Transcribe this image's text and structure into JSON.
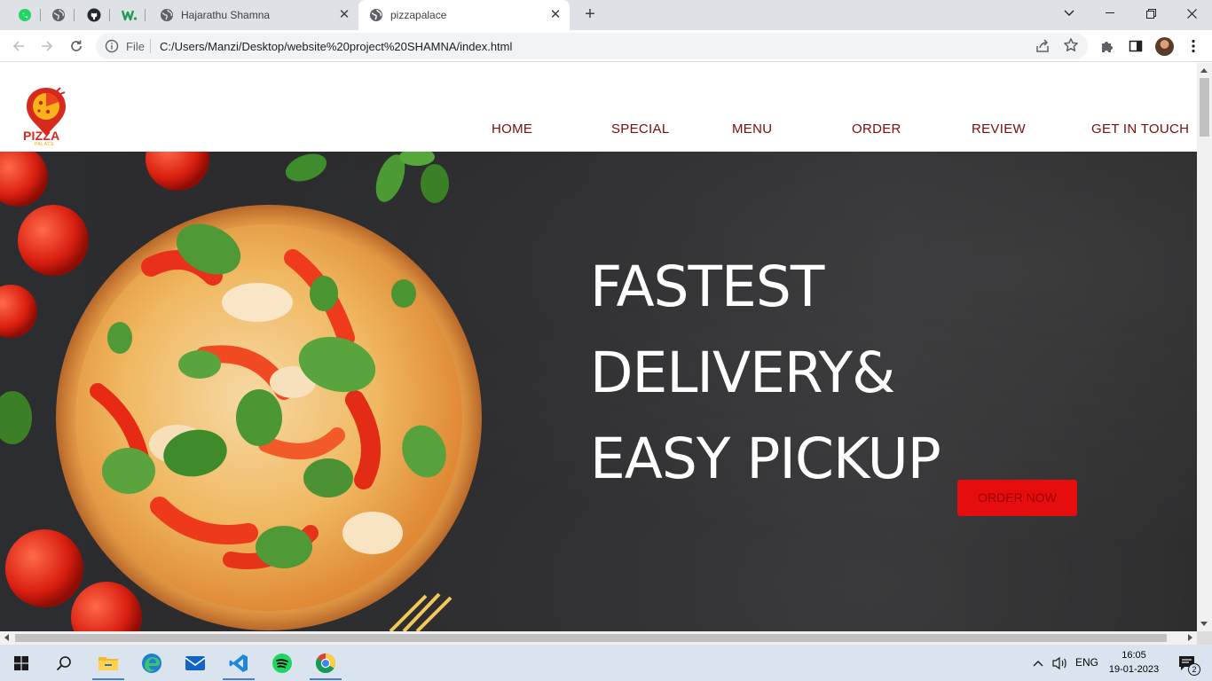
{
  "browser": {
    "pinned_tabs": [
      {
        "name": "whatsapp-tab",
        "icon": "whatsapp-icon"
      },
      {
        "name": "globe-tab",
        "icon": "globe-icon"
      },
      {
        "name": "github-tab",
        "icon": "github-icon"
      },
      {
        "name": "w-tab",
        "icon": "w-icon"
      }
    ],
    "tabs": [
      {
        "title": "Hajarathu Shamna",
        "active": false
      },
      {
        "title": "pizzapalace",
        "active": true
      }
    ],
    "address": {
      "scheme": "File",
      "url": "C:/Users/Manzi/Desktop/website%20project%20SHAMNA/index.html"
    }
  },
  "site": {
    "logo": {
      "text": "PIZZA",
      "subtext": "PALACE"
    },
    "nav": [
      "HOME",
      "SPECIAL",
      "MENU",
      "ORDER",
      "REVIEW",
      "GET IN TOUCH"
    ],
    "hero": {
      "lines": [
        "FASTEST",
        "DELIVERY&",
        "EASY PICKUP"
      ],
      "button": "ORDER NOW"
    }
  },
  "taskbar": {
    "apps": [
      "windows-start",
      "search",
      "file-explorer",
      "edge",
      "mail",
      "vscode",
      "spotify",
      "chrome"
    ],
    "language": "ENG",
    "time": "16:05",
    "date": "19-01-2023",
    "notifications": "2"
  },
  "colors": {
    "nav_text": "#7a0c0c",
    "accent_red": "#e50d0d",
    "hero_bg": "#2c2d30",
    "chrome_tabstrip": "#dee1e6"
  }
}
